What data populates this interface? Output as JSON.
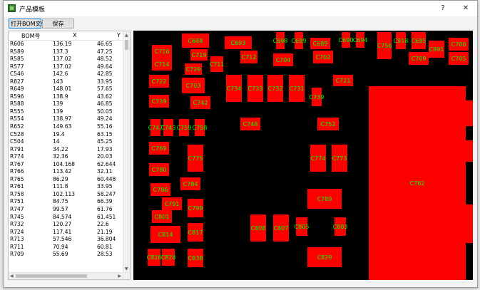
{
  "window": {
    "title": "产品模板",
    "help_glyph": "?",
    "close_glyph": "✕"
  },
  "toolbar": {
    "open_bom_label": "打开BOM文件",
    "save_label": "保存"
  },
  "table": {
    "columns": [
      "BOM号",
      "X",
      "Y"
    ],
    "rows": [
      [
        "R606",
        "136.19",
        "46.65"
      ],
      [
        "R589",
        "137.3",
        "47.25"
      ],
      [
        "R585",
        "137.02",
        "48.52"
      ],
      [
        "R577",
        "137.02",
        "49.64"
      ],
      [
        "C546",
        "142.6",
        "42.85"
      ],
      [
        "R827",
        "143",
        "33.95"
      ],
      [
        "R649",
        "148.01",
        "57.65"
      ],
      [
        "R596",
        "138.9",
        "43.62"
      ],
      [
        "R588",
        "139",
        "46.85"
      ],
      [
        "R555",
        "139",
        "50.05"
      ],
      [
        "R554",
        "138.97",
        "49.24"
      ],
      [
        "R652",
        "149.63",
        "55.16"
      ],
      [
        "C528",
        "19.4",
        "63.15"
      ],
      [
        "C504",
        "14",
        "45.25"
      ],
      [
        "R791",
        "34.22",
        "17.93"
      ],
      [
        "R774",
        "32.36",
        "20.03"
      ],
      [
        "R767",
        "104.168",
        "62.644"
      ],
      [
        "R766",
        "113.42",
        "32.11"
      ],
      [
        "R765",
        "86.29",
        "60.448"
      ],
      [
        "R761",
        "111.8",
        "33.95"
      ],
      [
        "R758",
        "102.113",
        "58.247"
      ],
      [
        "R751",
        "84.75",
        "66.39"
      ],
      [
        "R747",
        "99.57",
        "61.76"
      ],
      [
        "R745",
        "84.574",
        "61.451"
      ],
      [
        "R732",
        "120.27",
        "22.6"
      ],
      [
        "R724",
        "117.41",
        "21.19"
      ],
      [
        "R713",
        "57.546",
        "36.804"
      ],
      [
        "R711",
        "70.94",
        "60.81"
      ],
      [
        "R709",
        "55.69",
        "28.53"
      ]
    ]
  },
  "pcb": {
    "pad_color": "#ff0000",
    "label_color": "#00ff00",
    "background": "#000000",
    "components": [
      "C688",
      "C693",
      "C698",
      "C699",
      "C689",
      "C690",
      "C694",
      "C756",
      "C918",
      "C695",
      "C891",
      "C700",
      "C716",
      "C719",
      "C711",
      "C712",
      "C704",
      "C702",
      "C709",
      "C705",
      "C714",
      "C729",
      "C722",
      "C703",
      "C721",
      "C734",
      "C733",
      "C732",
      "C731",
      "C739",
      "C739",
      "C742",
      "C747",
      "C748",
      "C752",
      "C762",
      "C743",
      "C759",
      "C758",
      "C769",
      "C775",
      "C774",
      "C773",
      "C780",
      "C784",
      "C786",
      "C789",
      "C791",
      "C799",
      "C801",
      "C814",
      "C817",
      "C808",
      "C807",
      "C805",
      "C803",
      "C829",
      "C826",
      "C828",
      "C838"
    ]
  }
}
